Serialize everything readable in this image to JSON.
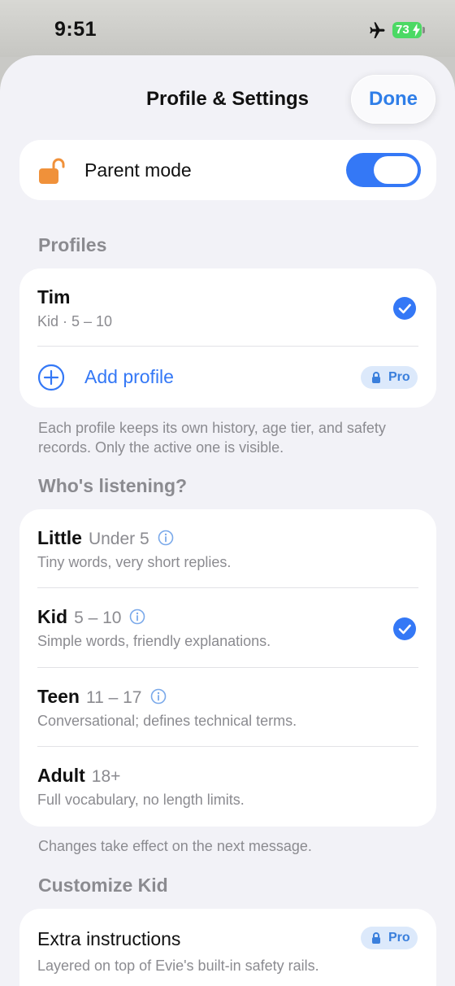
{
  "status_bar": {
    "time": "9:51",
    "battery": "73",
    "icons": [
      "airplane-icon",
      "battery-charging-icon"
    ]
  },
  "sheet": {
    "title": "Profile & Settings",
    "done_label": "Done"
  },
  "parent_mode": {
    "label": "Parent mode",
    "icon": "unlocked-padlock-icon",
    "enabled": true
  },
  "profiles": {
    "header": "Profiles",
    "items": [
      {
        "name": "Tim",
        "detail": "Kid · 5 – 10",
        "selected": true
      }
    ],
    "add_label": "Add profile",
    "add_badge": "Pro",
    "footnote": "Each profile keeps its own history, age tier, and safety records. Only the active one is visible."
  },
  "listening": {
    "header": "Who's listening?",
    "tiers": [
      {
        "name": "Little",
        "age": "Under 5",
        "desc": "Tiny words, very short replies.",
        "info": true,
        "selected": false
      },
      {
        "name": "Kid",
        "age": "5 – 10",
        "desc": "Simple words, friendly explanations.",
        "info": true,
        "selected": true
      },
      {
        "name": "Teen",
        "age": "11 – 17",
        "desc": "Conversational; defines technical terms.",
        "info": true,
        "selected": false
      },
      {
        "name": "Adult",
        "age": "18+",
        "desc": "Full vocabulary, no length limits.",
        "info": false,
        "selected": false
      }
    ],
    "footnote": "Changes take effect on the next message."
  },
  "customize": {
    "header": "Customize Kid",
    "extra_title": "Extra instructions",
    "extra_badge": "Pro",
    "extra_desc": "Layered on top of Evie's built-in safety rails."
  },
  "colors": {
    "accent": "#3478f6",
    "lock": "#f0913a",
    "badge_bg": "#dce9fb"
  }
}
